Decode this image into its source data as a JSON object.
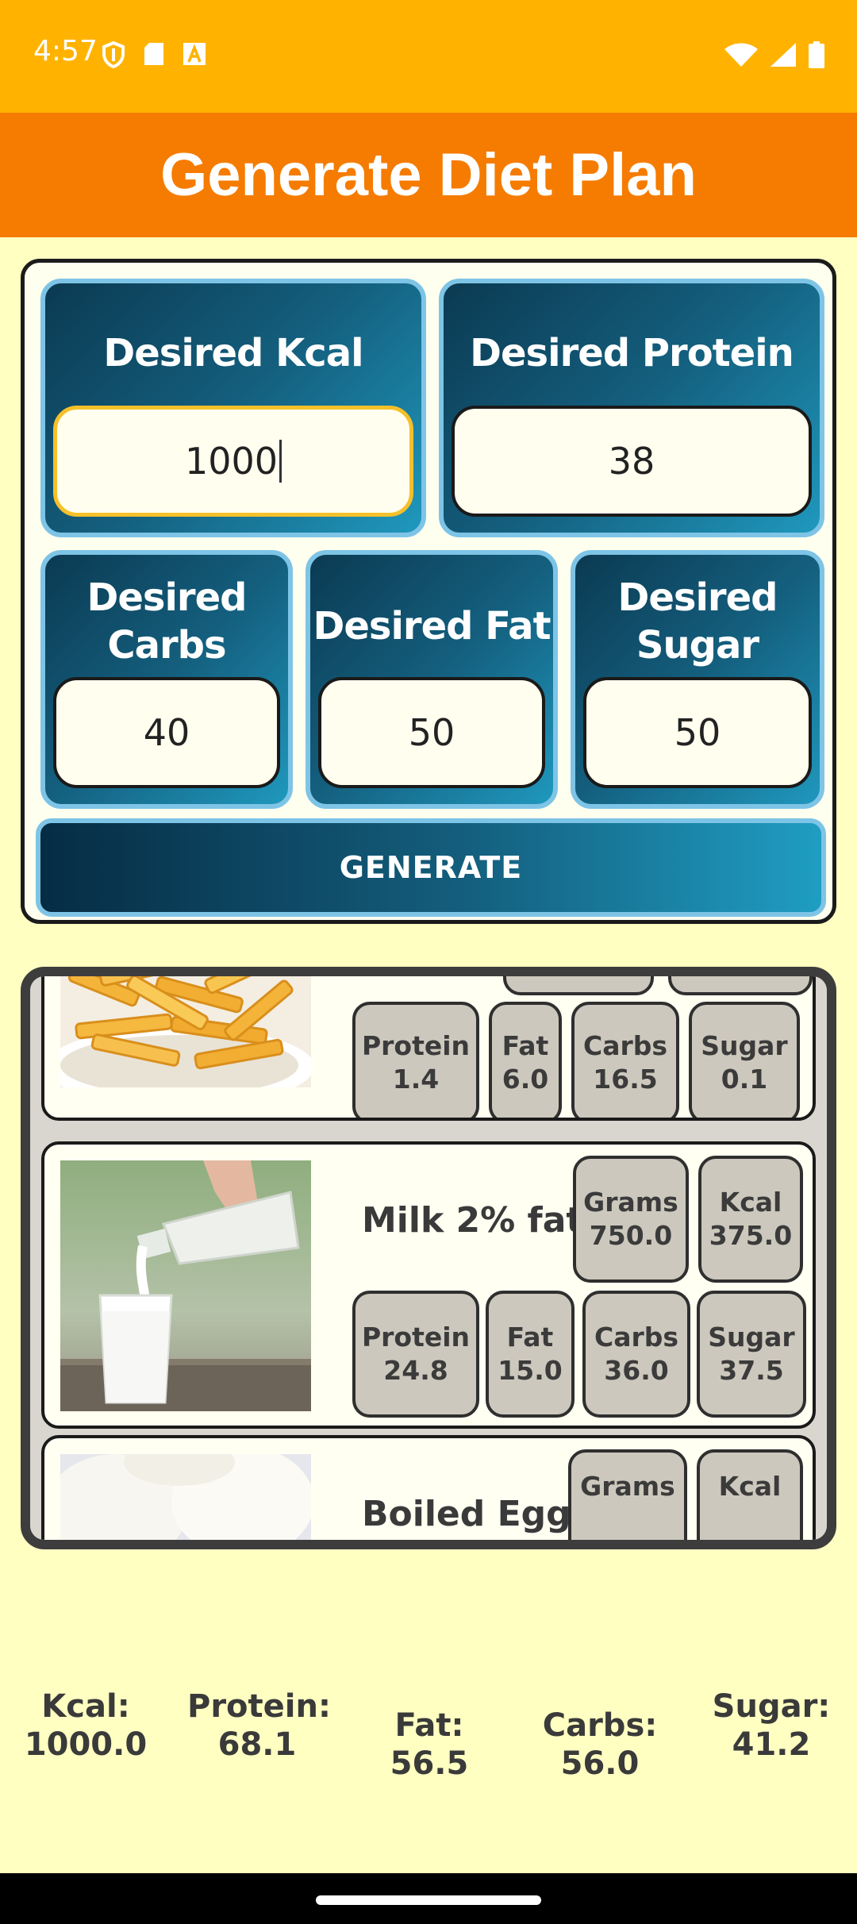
{
  "status_bar": {
    "time": "4:57",
    "left_icons": [
      "shield-icon",
      "sd-card-icon",
      "font-icon"
    ],
    "right_icons": [
      "wifi-icon",
      "signal-icon",
      "battery-icon"
    ]
  },
  "app_bar": {
    "title": "Generate Diet Plan",
    "color": "#F57C00"
  },
  "form": {
    "kcal": {
      "label": "Desired Kcal",
      "value": "1000"
    },
    "protein": {
      "label": "Desired Protein",
      "value": "38"
    },
    "carbs": {
      "label_line1": "Desired",
      "label_line2": "Carbs",
      "value": "40"
    },
    "fat": {
      "label": "Desired Fat",
      "value": "50"
    },
    "sugar": {
      "label_line1": "Desired",
      "label_line2": "Sugar",
      "value": "50"
    },
    "generate_label": "GENERATE"
  },
  "foods": [
    {
      "name": "",
      "image": "french-fries",
      "protein": {
        "label": "Protein",
        "value": "1.4"
      },
      "fat": {
        "label": "Fat",
        "value": "6.0"
      },
      "carbs": {
        "label": "Carbs",
        "value": "16.5"
      },
      "sugar": {
        "label": "Sugar",
        "value": "0.1"
      }
    },
    {
      "name": "Milk 2% fat",
      "image": "milk",
      "grams": {
        "label": "Grams",
        "value": "750.0"
      },
      "kcal": {
        "label": "Kcal",
        "value": "375.0"
      },
      "protein": {
        "label": "Protein",
        "value": "24.8"
      },
      "fat": {
        "label": "Fat",
        "value": "15.0"
      },
      "carbs": {
        "label": "Carbs",
        "value": "36.0"
      },
      "sugar": {
        "label": "Sugar",
        "value": "37.5"
      }
    },
    {
      "name": "Boiled Egg",
      "image": "boiled-egg",
      "grams": {
        "label": "Grams"
      },
      "kcal": {
        "label": "Kcal"
      }
    }
  ],
  "totals": {
    "kcal": {
      "label": "Kcal:",
      "value": "1000.0"
    },
    "protein": {
      "label": "Protein:",
      "value": "68.1"
    },
    "fat": "Fat: 56.5",
    "carbs": "Carbs: 56.0",
    "sugar": {
      "label": "Sugar:",
      "value": "41.2"
    }
  }
}
